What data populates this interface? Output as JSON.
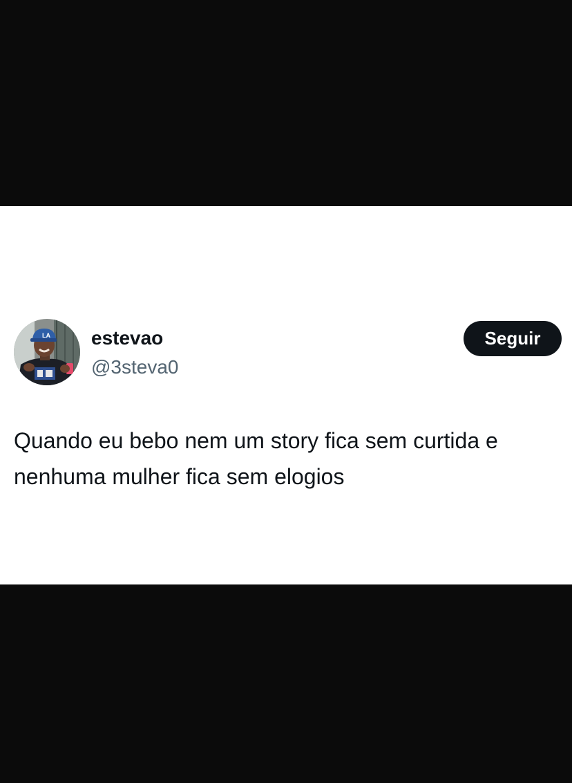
{
  "tweet": {
    "author": {
      "display_name": "estevao",
      "handle": "@3steva0"
    },
    "follow_button_label": "Seguir",
    "text": "Quando eu bebo nem um story fica sem curtida e\nnenhuma mulher fica sem elogios"
  },
  "colors": {
    "band": "#0b0b0b",
    "card": "#ffffff",
    "text_primary": "#0f1419",
    "text_secondary": "#536471",
    "button": "#0f1419"
  },
  "icons": {
    "avatar": "profile-photo"
  }
}
